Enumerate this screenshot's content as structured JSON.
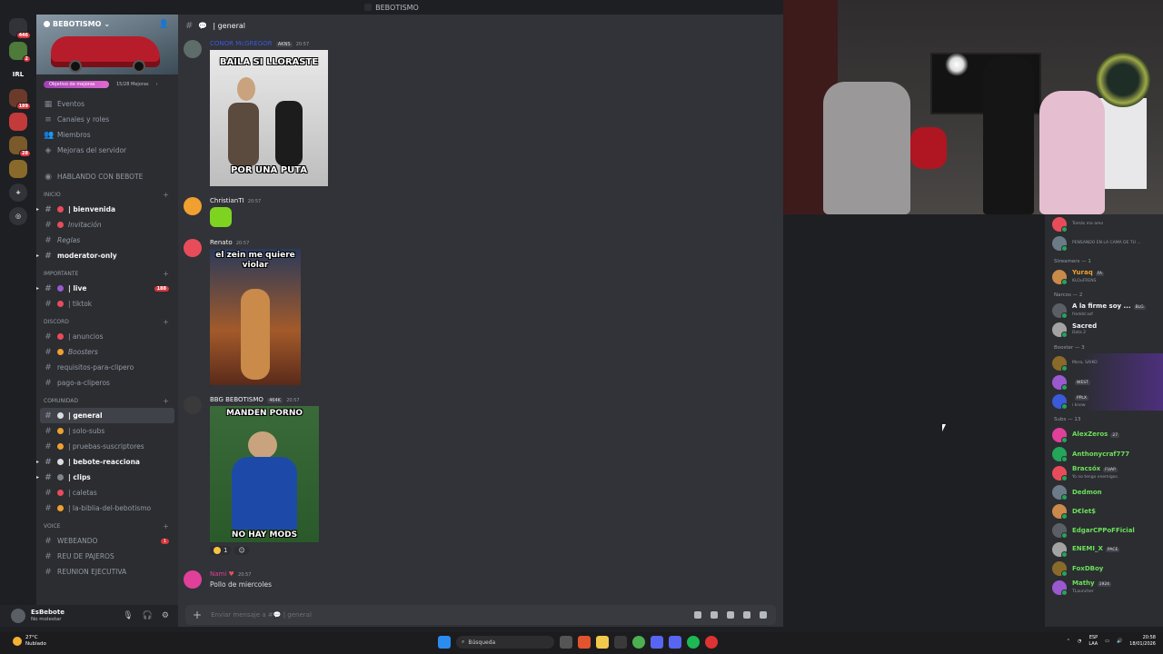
{
  "window": {
    "title": "BEBOTISMO"
  },
  "rail": {
    "servers": [
      {
        "label": "",
        "badge": "446",
        "color": "#313338"
      },
      {
        "label": "",
        "badge": "2",
        "color": "#4e7a3a"
      },
      {
        "label": "IRL",
        "badge": "",
        "color": "#1e1f22"
      },
      {
        "label": "",
        "badge": "189",
        "color": "#6b3a2a"
      },
      {
        "label": "",
        "badge": "",
        "color": "#c23a3a"
      },
      {
        "label": "",
        "badge": "28",
        "color": "#7a5a2a"
      },
      {
        "label": "",
        "badge": "",
        "color": "#8a6a2a"
      },
      {
        "label": "+",
        "badge": "",
        "color": "#313338"
      },
      {
        "label": "◎",
        "badge": "",
        "color": "#313338"
      }
    ]
  },
  "server": {
    "name": "BEBOTISMO",
    "boost_label": "Objetivo de mejoras",
    "boost_count": "15/28 Mejoras",
    "menu": [
      "Eventos",
      "Canales y roles",
      "Miembros",
      "Mejoras del servidor"
    ],
    "special": "HABLANDO CON BEBOTE"
  },
  "channels": [
    {
      "kind": "cat",
      "name": "INICIO"
    },
    {
      "kind": "ch",
      "name": "| bienvenida",
      "bold": true,
      "emoji": "#e84c5a",
      "arrow": true
    },
    {
      "kind": "ch",
      "name": "Invitación",
      "italic": true,
      "emoji": "#e84c5a"
    },
    {
      "kind": "ch",
      "name": "Reglas",
      "italic": true,
      "emoji": ""
    },
    {
      "kind": "ch",
      "name": "moderator-only",
      "bold": true,
      "emoji": "",
      "arrow": true
    },
    {
      "kind": "cat",
      "name": "IMPORTANTE"
    },
    {
      "kind": "ch",
      "name": "| live",
      "bold": true,
      "emoji": "#9b59d0",
      "arrow": true,
      "count": "188"
    },
    {
      "kind": "ch",
      "name": "| tiktok",
      "emoji": "#e84c5a"
    },
    {
      "kind": "cat",
      "name": "DISCORD"
    },
    {
      "kind": "ch",
      "name": "| anuncios",
      "emoji": "#e84c5a"
    },
    {
      "kind": "ch",
      "name": "Boosters",
      "italic": true,
      "emoji": "#f0a030"
    },
    {
      "kind": "ch",
      "name": "requisitos-para-clipero",
      "emoji": ""
    },
    {
      "kind": "ch",
      "name": "pago-a-cliperos",
      "emoji": ""
    },
    {
      "kind": "cat",
      "name": "COMUNIDAD"
    },
    {
      "kind": "ch",
      "name": "| general",
      "bold": true,
      "active": true,
      "emoji": "#dbdee1"
    },
    {
      "kind": "ch",
      "name": "| solo-subs",
      "emoji": "#f0a030"
    },
    {
      "kind": "ch",
      "name": "| pruebas-suscriptores",
      "emoji": "#f0a030"
    },
    {
      "kind": "ch",
      "name": "| bebote-reacciona",
      "bold": true,
      "emoji": "#dbdee1",
      "arrow": true
    },
    {
      "kind": "ch",
      "name": "| clips",
      "bold": true,
      "emoji": "#80848e",
      "arrow": true
    },
    {
      "kind": "ch",
      "name": "| caletas",
      "emoji": "#e84c5a"
    },
    {
      "kind": "ch",
      "name": "| la-biblia-del-bebotismo",
      "emoji": "#f0a030"
    },
    {
      "kind": "cat",
      "name": "VOICE"
    },
    {
      "kind": "ch",
      "name": "WEBEANDO",
      "emoji": "",
      "count": "1"
    },
    {
      "kind": "ch",
      "name": "REU DE PAJEROS",
      "emoji": ""
    },
    {
      "kind": "ch",
      "name": "REUNION EJECUTIVA",
      "emoji": ""
    }
  ],
  "user": {
    "name": "EsBebote",
    "status": "No molestar"
  },
  "chat": {
    "channel": "| general",
    "composer_placeholder": "Enviar mensaje a #💬 | general",
    "messages": [
      {
        "author": "CONOR McGREGOR",
        "author_color": "#3a5ad9",
        "tag": "AKNS",
        "time": "20:57",
        "media_top": "BAILA SI LLORASTE",
        "media_bottom": "POR UNA PUTA"
      },
      {
        "author": "ChristianTI",
        "author_color": "#f2f3f5",
        "tag": "",
        "time": "20:57"
      },
      {
        "author": "Renato",
        "author_color": "#f2f3f5",
        "tag": "",
        "time": "20:57",
        "media_top": "el zein me quiere violar"
      },
      {
        "author": "BBG BEBOTISMO",
        "author_color": "#f2f3f5",
        "tag": "464K",
        "time": "20:57",
        "media_top": "MANDEN PORNO",
        "media_bottom": "NO HAY MODS",
        "reaction_count": "1"
      },
      {
        "author": "Nami",
        "author_color": "#e0409a",
        "tag": "",
        "time": "20:57",
        "text": "Pollo de miercoles"
      }
    ]
  },
  "members": {
    "top": [
      {
        "name": "",
        "status": "Tomás ma amo",
        "color": "#3a5ad9"
      },
      {
        "name": "",
        "status": "PENSANDO EN LA CAMA DE TU ...",
        "color": "#3a5ad9"
      }
    ],
    "groups": [
      {
        "title": "Streamers — 1",
        "items": [
          {
            "name": "Yuraq",
            "tag": "FA",
            "status": "KLOuFRENS",
            "color": "#f0a030"
          }
        ]
      },
      {
        "title": "Narcos — 2",
        "items": [
          {
            "name": "A la firme soy ...",
            "tag": "BLG",
            "status": "freddd asf",
            "color": "#f2f3f5"
          },
          {
            "name": "Sacred",
            "tag": "",
            "status": "Dota 2",
            "color": "#f2f3f5"
          }
        ]
      },
      {
        "title": "Booster — 3",
        "items": [
          {
            "name": "",
            "tag": "",
            "status": "Mora, SAIKO",
            "color": "#9b59d0"
          },
          {
            "name": "",
            "tag": "WEST",
            "status": "",
            "color": "#9b59d0"
          },
          {
            "name": "",
            "tag": "PPLX",
            "status": "i know",
            "color": "#9b59d0"
          }
        ]
      },
      {
        "title": "Subs — 13",
        "items": [
          {
            "name": "AlexZeros",
            "tag": "27",
            "status": "",
            "color": "#6ce05a"
          },
          {
            "name": "Anthonycraf777",
            "tag": "",
            "status": "",
            "color": "#6ce05a"
          },
          {
            "name": "Bracsóx",
            "tag": "FUAP",
            "status": "Yo no tengo enemigos.",
            "color": "#6ce05a"
          },
          {
            "name": "Dedmon",
            "tag": "",
            "status": "",
            "color": "#6ce05a"
          },
          {
            "name": "D€let$",
            "tag": "",
            "status": "",
            "color": "#6ce05a"
          },
          {
            "name": "EdgarCPPoFFicial",
            "tag": "",
            "status": "",
            "color": "#6ce05a"
          },
          {
            "name": "ENEMI_X",
            "tag": "PACE",
            "status": "",
            "color": "#6ce05a"
          },
          {
            "name": "FoxDBoy",
            "tag": "",
            "status": "",
            "color": "#6ce05a"
          },
          {
            "name": "Mathy",
            "tag": "1924",
            "status": "TLauncher",
            "color": "#6ce05a"
          }
        ]
      }
    ]
  },
  "taskbar": {
    "temp": "27°C",
    "weather": "Nublado",
    "search_placeholder": "Búsqueda",
    "lang": "ESP",
    "lang2": "LAA",
    "time": "20:58",
    "date": "18/01/2026"
  }
}
